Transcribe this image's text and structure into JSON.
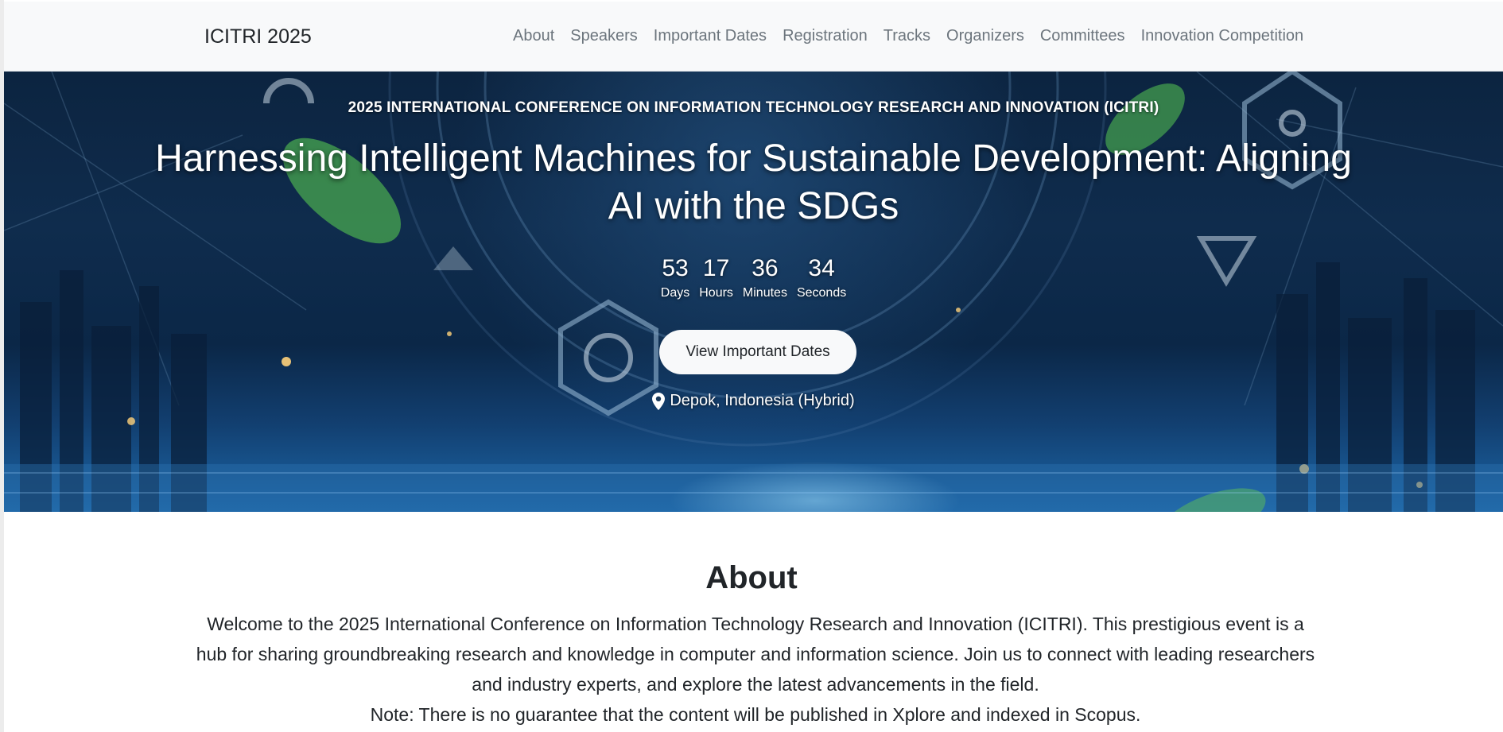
{
  "navbar": {
    "brand": "ICITRI 2025",
    "links": [
      "About",
      "Speakers",
      "Important Dates",
      "Registration",
      "Tracks",
      "Organizers",
      "Committees",
      "Innovation Competition"
    ]
  },
  "hero": {
    "eyebrow": "2025 INTERNATIONAL CONFERENCE ON INFORMATION TECHNOLOGY RESEARCH AND INNOVATION (ICITRI)",
    "headline": "Harnessing Intelligent Machines for Sustainable Development: Aligning AI with the SDGs",
    "countdown": [
      {
        "value": "53",
        "label": "Days"
      },
      {
        "value": "17",
        "label": "Hours"
      },
      {
        "value": "36",
        "label": "Minutes"
      },
      {
        "value": "34",
        "label": "Seconds"
      }
    ],
    "cta_label": "View Important Dates",
    "location_icon": "map-marker-icon",
    "location": "Depok, Indonesia (Hybrid)"
  },
  "about": {
    "title": "About",
    "body": "Welcome to the 2025 International Conference on Information Technology Research and Innovation (ICITRI). This prestigious event is a hub for sharing groundbreaking research and knowledge in computer and information science. Join us to connect with leading researchers and industry experts, and explore the latest advancements in the field.",
    "note": "Note: There is no guarantee that the content will be published in Xplore and indexed in Scopus."
  },
  "colors": {
    "navbar_bg": "#f8f9fa",
    "nav_link": "#6c757d",
    "hero_dark": "#0c2440",
    "hero_glow": "#1c67a8",
    "leaf_green": "#4caf50"
  }
}
